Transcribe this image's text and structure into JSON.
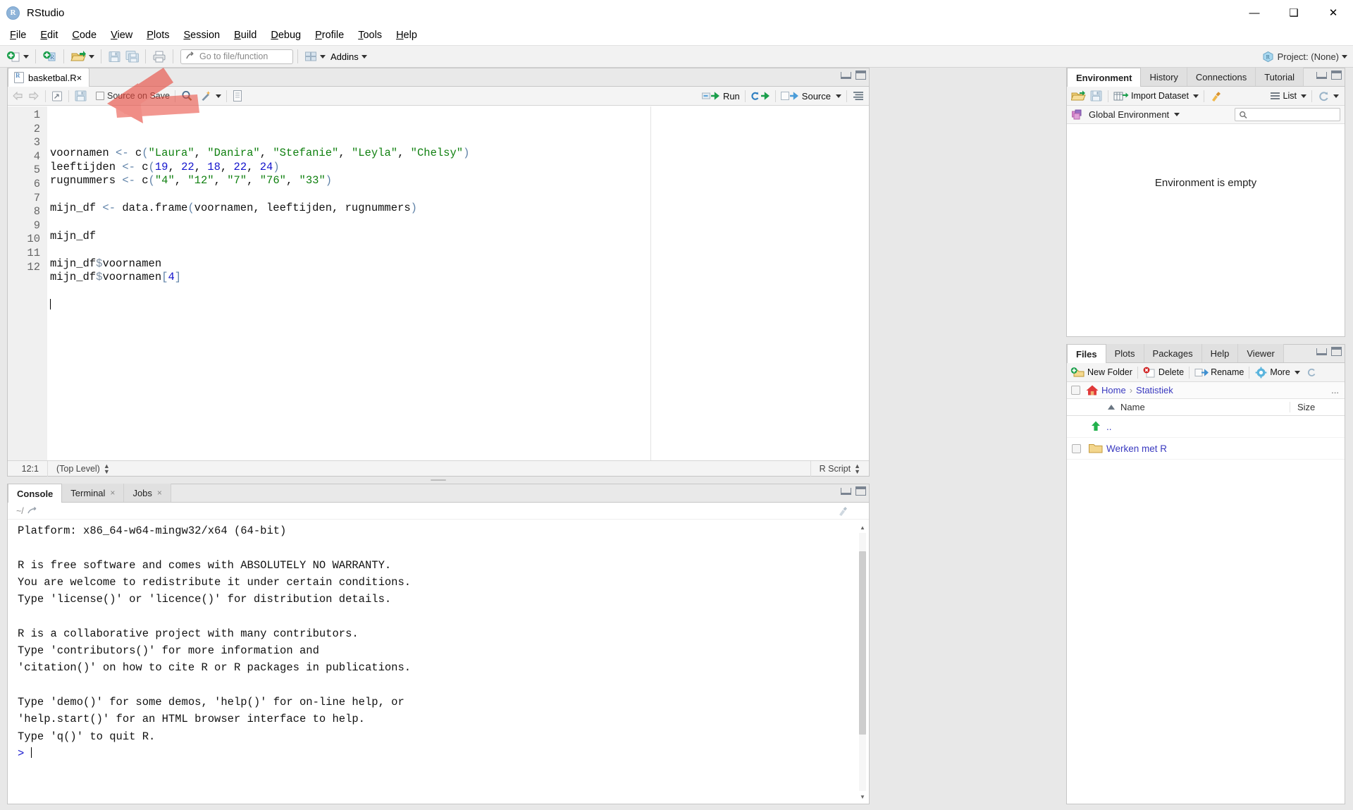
{
  "window": {
    "app_name": "RStudio",
    "icon": "r-logo-icon",
    "minimize": "minimize-icon",
    "maximize": "maximize-icon",
    "close": "close-icon"
  },
  "menubar": {
    "items": [
      {
        "label": "File",
        "accel": "F"
      },
      {
        "label": "Edit",
        "accel": "E"
      },
      {
        "label": "Code",
        "accel": "C"
      },
      {
        "label": "View",
        "accel": "V"
      },
      {
        "label": "Plots",
        "accel": "P"
      },
      {
        "label": "Session",
        "accel": "S"
      },
      {
        "label": "Build",
        "accel": "B"
      },
      {
        "label": "Debug",
        "accel": "D"
      },
      {
        "label": "Profile",
        "accel": "P"
      },
      {
        "label": "Tools",
        "accel": "T"
      },
      {
        "label": "Help",
        "accel": "H"
      }
    ]
  },
  "toolbar": {
    "new_file": "new-file-icon",
    "new_project": "new-project-icon",
    "open_file": "open-file-icon",
    "save": "save-icon",
    "save_all": "save-all-icon",
    "print": "print-icon",
    "goto_placeholder": "Go to file/function",
    "panes_layout": "panes-layout-icon",
    "addins_label": "Addins",
    "project_label": "Project: (None)"
  },
  "source_pane": {
    "file_tab": "basketbal.R",
    "tab_close": "×",
    "toolbar": {
      "back": "back-arrow-icon",
      "forward": "forward-arrow-icon",
      "popout": "show-in-new-window-icon",
      "save": "save-icon",
      "source_on_save_label": "Source on Save",
      "find": "find-icon",
      "magic_wand": "code-tools-icon",
      "compile_report": "compile-report-icon",
      "run_label": "Run",
      "rerun": "re-run-icon",
      "source_label": "Source",
      "outline": "document-outline-icon"
    },
    "code_lines": [
      {
        "n": 1,
        "text": "voornamen <- c(\"Laura\", \"Danira\", \"Stefanie\", \"Leyla\", \"Chelsy\")"
      },
      {
        "n": 2,
        "text": "leeftijden <- c(19, 22, 18, 22, 24)"
      },
      {
        "n": 3,
        "text": "rugnummers <- c(\"4\", \"12\", \"7\", \"76\", \"33\")"
      },
      {
        "n": 4,
        "text": ""
      },
      {
        "n": 5,
        "text": "mijn_df <- data.frame(voornamen, leeftijden, rugnummers)"
      },
      {
        "n": 6,
        "text": ""
      },
      {
        "n": 7,
        "text": "mijn_df"
      },
      {
        "n": 8,
        "text": ""
      },
      {
        "n": 9,
        "text": "mijn_df$voornamen"
      },
      {
        "n": 10,
        "text": "mijn_df$voornamen[4]"
      },
      {
        "n": 11,
        "text": ""
      },
      {
        "n": 12,
        "text": ""
      }
    ],
    "status": {
      "cursor_position": "12:1",
      "scope": "(Top Level)",
      "file_type": "R Script"
    }
  },
  "console_pane": {
    "tabs": [
      {
        "label": "Console",
        "closable": false,
        "active": true
      },
      {
        "label": "Terminal",
        "closable": true,
        "active": false
      },
      {
        "label": "Jobs",
        "closable": true,
        "active": false
      }
    ],
    "working_dir": "~/",
    "open_dir_icon": "open-directory-icon",
    "clear_icon": "clear-console-icon",
    "output_lines": [
      "Platform: x86_64-w64-mingw32/x64 (64-bit)",
      "",
      "R is free software and comes with ABSOLUTELY NO WARRANTY.",
      "You are welcome to redistribute it under certain conditions.",
      "Type 'license()' or 'licence()' for distribution details.",
      "",
      "R is a collaborative project with many contributors.",
      "Type 'contributors()' for more information and",
      "'citation()' on how to cite R or R packages in publications.",
      "",
      "Type 'demo()' for some demos, 'help()' for on-line help, or",
      "'help.start()' for an HTML browser interface to help.",
      "Type 'q()' to quit R."
    ],
    "prompt": ">"
  },
  "environment_pane": {
    "tabs": [
      {
        "label": "Environment",
        "active": true
      },
      {
        "label": "History",
        "active": false
      },
      {
        "label": "Connections",
        "active": false
      },
      {
        "label": "Tutorial",
        "active": false
      }
    ],
    "toolbar": {
      "load_workspace": "open-folder-icon",
      "save_workspace": "save-icon",
      "import_dataset_label": "Import Dataset",
      "clear_objects": "broom-icon",
      "view_mode_label": "List",
      "refresh": "refresh-icon"
    },
    "scope_label": "Global Environment",
    "scope_icon": "cubes-icon",
    "search_icon": "search-icon",
    "search_value": "",
    "empty_message": "Environment is empty"
  },
  "files_pane": {
    "tabs": [
      {
        "label": "Files",
        "active": true
      },
      {
        "label": "Plots",
        "active": false
      },
      {
        "label": "Packages",
        "active": false
      },
      {
        "label": "Help",
        "active": false
      },
      {
        "label": "Viewer",
        "active": false
      }
    ],
    "toolbar": {
      "new_folder_label": "New Folder",
      "new_folder_icon": "new-folder-icon",
      "delete_label": "Delete",
      "delete_icon": "delete-icon",
      "rename_label": "Rename",
      "rename_icon": "rename-icon",
      "more_label": "More",
      "more_icon": "gear-icon"
    },
    "breadcrumb": {
      "home_icon": "home-icon",
      "items": [
        "Home",
        "Statistiek"
      ],
      "separator": "›",
      "overflow": "..."
    },
    "columns": [
      "Name",
      "Size"
    ],
    "sort_icon": "sort-ascending-icon",
    "rows": [
      {
        "name": "..",
        "size": "",
        "icon": "up-folder-icon",
        "checkbox": false
      },
      {
        "name": "Werken met R",
        "size": "",
        "icon": "folder-icon",
        "checkbox": true
      }
    ]
  },
  "annotation": {
    "type": "arrow-annotation",
    "color": "#e8736b",
    "points_at": "save-icon"
  }
}
